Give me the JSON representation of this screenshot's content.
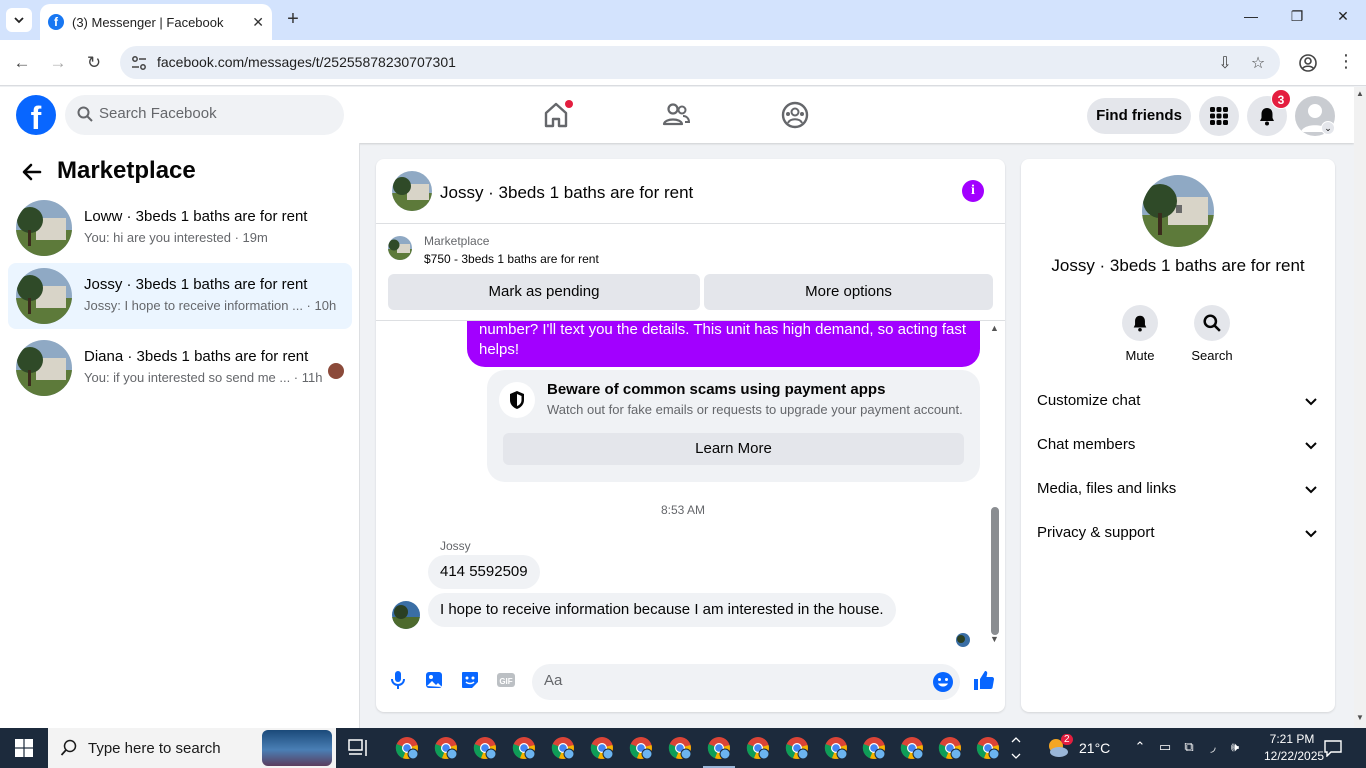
{
  "browser": {
    "tab_title": "(3) Messenger | Facebook",
    "url": "facebook.com/messages/t/25255878230707301"
  },
  "fb_header": {
    "logo": "f",
    "search_placeholder": "Search Facebook",
    "find_friends_label": "Find friends",
    "notification_count": "3"
  },
  "sidebar": {
    "title": "Marketplace",
    "conversations": [
      {
        "name": "Loww · 3beds 1 baths are for rent",
        "snippet": "You: hi are you interested · 19m",
        "active": false
      },
      {
        "name": "Jossy · 3beds 1 baths are for rent",
        "snippet": "Jossy: I hope to receive information ... · 10h",
        "active": true
      },
      {
        "name": "Diana · 3beds 1 baths are for rent",
        "snippet": "You: if you interested so send me ... · 11h",
        "active": false
      }
    ]
  },
  "chat": {
    "title": "Jossy · 3beds 1 baths are for rent",
    "marketplace_label": "Marketplace",
    "listing": "$750 - 3beds 1 baths are for rent",
    "mark_pending_label": "Mark as pending",
    "more_options_label": "More options",
    "outgoing_message": "number? I'll text you the details. This unit has high demand, so acting fast helps!",
    "scam_title": "Beware of common scams using payment apps",
    "scam_text": "Watch out for fake emails or requests to upgrade your payment account.",
    "learn_more_label": "Learn More",
    "timestamp": "8:53 AM",
    "sender": "Jossy",
    "incoming_1": "414 5592509",
    "incoming_2": "I hope to receive information because I am interested in the house.",
    "composer_placeholder": "Aa"
  },
  "details": {
    "name": "Jossy · 3beds 1 baths are for rent",
    "mute_label": "Mute",
    "search_label": "Search",
    "sections": [
      "Customize chat",
      "Chat members",
      "Media, files and links",
      "Privacy & support"
    ]
  },
  "taskbar": {
    "search_placeholder": "Type here to search",
    "temperature": "21°C",
    "weather_badge": "2",
    "time": "7:21 PM",
    "date": "12/22/2025"
  },
  "colors": {
    "fb_blue": "#0866ff",
    "messenger_purple": "#a200ff",
    "notification_red": "#e41e3f"
  }
}
